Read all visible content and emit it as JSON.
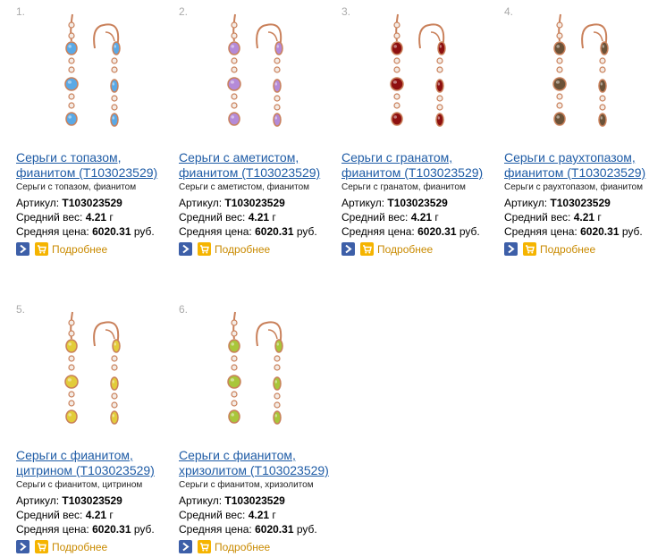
{
  "colors": {
    "link": "#1f5ca6",
    "more_link": "#c98a00",
    "go_button": "#3d5fa8",
    "cart_button": "#f5b400",
    "gold": "#c9805a"
  },
  "products": [
    {
      "number": "1.",
      "title": "Серьги с топазом,\nфианитом (Т103023529)",
      "desc": "Серьги с топазом, фианитом",
      "article_label": "Артикул:",
      "article": "Т103023529",
      "weight_label": "Средний вес:",
      "weight": "4.21",
      "weight_unit": "г",
      "price_label": "Средняя цена:",
      "price": "6020.31",
      "price_unit": "руб.",
      "more": "Подробнее",
      "stone_color": "#5aa9e6",
      "stone_icon": "earrings-photo"
    },
    {
      "number": "2.",
      "title": "Серьги с аметистом,\nфианитом (Т103023529)",
      "desc": "Серьги с аметистом, фианитом",
      "article_label": "Артикул:",
      "article": "Т103023529",
      "weight_label": "Средний вес:",
      "weight": "4.21",
      "weight_unit": "г",
      "price_label": "Средняя цена:",
      "price": "6020.31",
      "price_unit": "руб.",
      "more": "Подробнее",
      "stone_color": "#b48ad8",
      "stone_icon": "earrings-photo"
    },
    {
      "number": "3.",
      "title": "Серьги с гранатом,\nфианитом (Т103023529)",
      "desc": "Серьги с гранатом, фианитом",
      "article_label": "Артикул:",
      "article": "Т103023529",
      "weight_label": "Средний вес:",
      "weight": "4.21",
      "weight_unit": "г",
      "price_label": "Средняя цена:",
      "price": "6020.31",
      "price_unit": "руб.",
      "more": "Подробнее",
      "stone_color": "#8e1010",
      "stone_icon": "earrings-photo"
    },
    {
      "number": "4.",
      "title": "Серьги с раухтопазом,\nфианитом (Т103023529)",
      "desc": "Серьги с раухтопазом, фианитом",
      "article_label": "Артикул:",
      "article": "Т103023529",
      "weight_label": "Средний вес:",
      "weight": "4.21",
      "weight_unit": "г",
      "price_label": "Средняя цена:",
      "price": "6020.31",
      "price_unit": "руб.",
      "more": "Подробнее",
      "stone_color": "#6b5238",
      "stone_icon": "earrings-photo"
    },
    {
      "number": "5.",
      "title": "Серьги с фианитом,\nцитрином (Т103023529)",
      "desc": "Серьги с фианитом, цитрином",
      "article_label": "Артикул:",
      "article": "Т103023529",
      "weight_label": "Средний вес:",
      "weight": "4.21",
      "weight_unit": "г",
      "price_label": "Средняя цена:",
      "price": "6020.31",
      "price_unit": "руб.",
      "more": "Подробнее",
      "stone_color": "#e2cc3a",
      "stone_icon": "earrings-photo"
    },
    {
      "number": "6.",
      "title": "Серьги с фианитом,\nхризолитом (Т103023529)",
      "desc": "Серьги с фианитом, хризолитом",
      "article_label": "Артикул:",
      "article": "Т103023529",
      "weight_label": "Средний вес:",
      "weight": "4.21",
      "weight_unit": "г",
      "price_label": "Средняя цена:",
      "price": "6020.31",
      "price_unit": "руб.",
      "more": "Подробнее",
      "stone_color": "#a9c63a",
      "stone_icon": "earrings-photo"
    }
  ]
}
